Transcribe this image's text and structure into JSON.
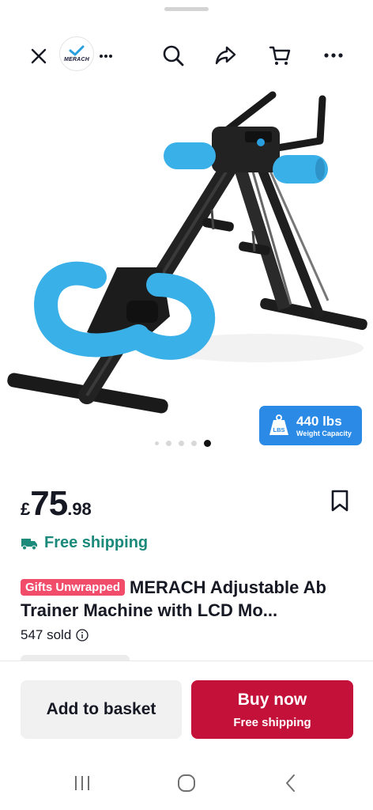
{
  "top_bar": {
    "close_icon": "close-icon",
    "store_logo_text": "MERACH",
    "store_more_icon": "more-horizontal-icon",
    "search_icon": "search-icon",
    "share_icon": "share-icon",
    "cart_icon": "cart-icon",
    "more_icon": "more-horizontal-icon"
  },
  "gallery": {
    "badge_value": "440 lbs",
    "badge_caption": "Weight Capacity",
    "badge_icon_label": "LBS",
    "image_count": 5,
    "current_index": 5
  },
  "product": {
    "price_currency": "£",
    "price_main": "75",
    "price_decimal": ".98",
    "shipping_text": "Free shipping",
    "tag": "Gifts Unwrapped",
    "title": "MERACH Adjustable Ab Trainer Machine with LCD Mo...",
    "sold": "547 sold"
  },
  "actions": {
    "basket_label": "Add to basket",
    "buy_label": "Buy now",
    "buy_sub": "Free shipping"
  },
  "colors": {
    "accent": "#c4113a",
    "shipping": "#1b8a7a",
    "tag": "#f24c6b",
    "badge": "#2a8ae6",
    "foam": "#3ab0e8"
  },
  "nav": {
    "recent_icon": "recent-apps-icon",
    "home_icon": "home-icon",
    "back_icon": "back-icon"
  }
}
